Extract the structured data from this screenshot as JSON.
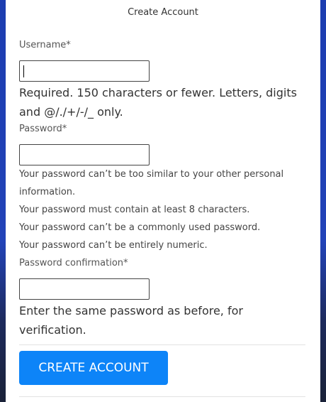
{
  "form": {
    "title": "Create Account",
    "username": {
      "label": "Username*",
      "value": "",
      "help": "Required. 150 characters or fewer. Letters, digits and @/./+/-/_ only."
    },
    "password": {
      "label": "Password*",
      "value": "",
      "help": [
        "Your password can’t be too similar to your other personal information.",
        "Your password must contain at least 8 characters.",
        "Your password can’t be a commonly used password.",
        "Your password can’t be entirely numeric."
      ]
    },
    "password_confirmation": {
      "label": "Password confirmation*",
      "value": "",
      "help": "Enter the same password as before, for verification."
    },
    "submit_label": "CREATE ACCOUNT"
  },
  "colors": {
    "button": "#0d84f8",
    "background": "#2243b8"
  }
}
